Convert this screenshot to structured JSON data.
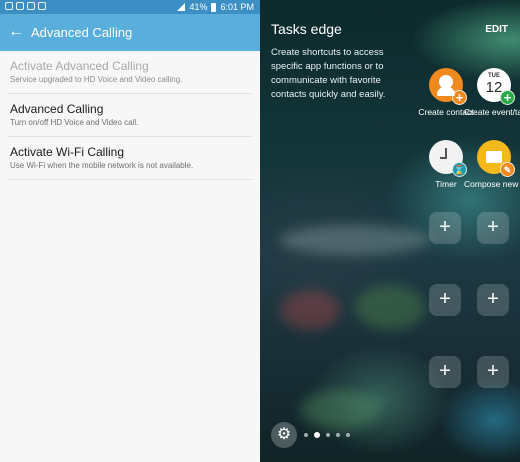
{
  "status_bar": {
    "battery": "41%",
    "time": "6:01 PM"
  },
  "settings_screen": {
    "title": "Advanced Calling",
    "items": [
      {
        "title": "Activate Advanced Calling",
        "subtitle": "Service upgraded to HD Voice and Video calling.",
        "disabled": true
      },
      {
        "title": "Advanced Calling",
        "subtitle": "Turn on/off HD Voice and Video call.",
        "disabled": false
      },
      {
        "title": "Activate Wi-Fi Calling",
        "subtitle": "Use Wi-Fi when the mobile network is not available.",
        "disabled": false
      }
    ]
  },
  "tasks_edge": {
    "title": "Tasks edge",
    "edit_label": "EDIT",
    "description": "Create shortcuts to access specific app functions or to communicate with favorite contacts quickly and easily.",
    "tiles": [
      {
        "label": "Create contact",
        "icon": "contact-icon"
      },
      {
        "label": "Create event/task",
        "icon": "calendar-icon",
        "calendar_day": "TUE",
        "calendar_date": "12"
      },
      {
        "label": "Timer",
        "icon": "timer-icon"
      },
      {
        "label": "Compose new mess...",
        "icon": "message-icon"
      }
    ],
    "add_symbol": "+",
    "page_count": 5,
    "active_page": 2
  },
  "colors": {
    "status_bar": "#3c8fc4",
    "app_bar": "#5aaedc",
    "contact_orange": "#f0891e",
    "calendar_green": "#2ca84a",
    "message_yellow": "#f3b81a",
    "timer_teal": "#1f9aa8"
  }
}
